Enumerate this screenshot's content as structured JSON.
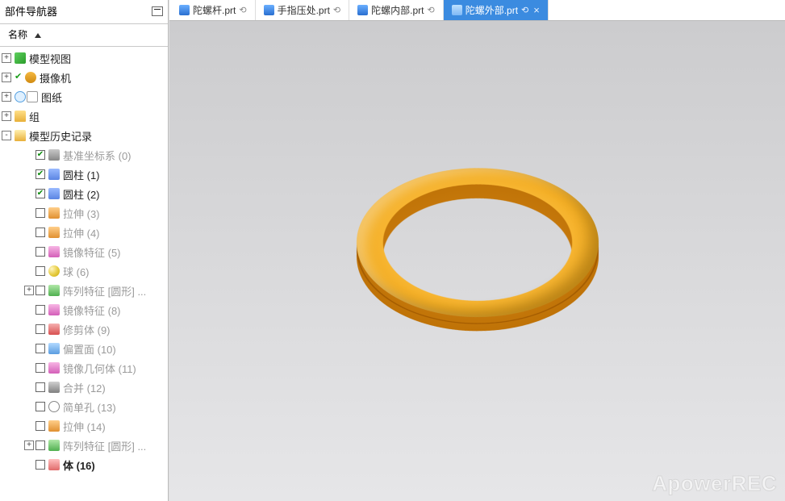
{
  "sidebar": {
    "title": "部件导航器",
    "columnHeader": "名称",
    "nodes": [
      {
        "level": 0,
        "exp": "+",
        "icons": [
          "cube"
        ],
        "label": "模型视图",
        "dim": false,
        "bold": false
      },
      {
        "level": 0,
        "exp": "+",
        "icons": [
          "check",
          "cam"
        ],
        "label": "摄像机",
        "dim": false,
        "bold": false
      },
      {
        "level": 0,
        "exp": "+",
        "icons": [
          "clock",
          "sheet"
        ],
        "label": "图纸",
        "dim": false,
        "bold": false
      },
      {
        "level": 0,
        "exp": "+",
        "icons": [
          "folder"
        ],
        "label": "组",
        "dim": false,
        "bold": false
      },
      {
        "level": 0,
        "exp": "-",
        "icons": [
          "folder-open"
        ],
        "label": "模型历史记录",
        "dim": false,
        "bold": false
      },
      {
        "level": 1,
        "chk": true,
        "icons": [
          "datum"
        ],
        "label": "基准坐标系 (0)",
        "dim": true
      },
      {
        "level": 1,
        "chk": true,
        "icons": [
          "cyl"
        ],
        "label": "圆柱 (1)",
        "dim": false
      },
      {
        "level": 1,
        "chk": true,
        "icons": [
          "cyl"
        ],
        "label": "圆柱 (2)",
        "dim": false
      },
      {
        "level": 1,
        "chk": false,
        "icons": [
          "ext"
        ],
        "label": "拉伸 (3)",
        "dim": true
      },
      {
        "level": 1,
        "chk": false,
        "icons": [
          "ext"
        ],
        "label": "拉伸 (4)",
        "dim": true
      },
      {
        "level": 1,
        "chk": false,
        "icons": [
          "mir"
        ],
        "label": "镜像特征 (5)",
        "dim": true
      },
      {
        "level": 1,
        "chk": false,
        "icons": [
          "sphere"
        ],
        "label": "球 (6)",
        "dim": true
      },
      {
        "level": 1,
        "exp": "+",
        "chk": false,
        "icons": [
          "patt"
        ],
        "label": "阵列特征 [圆形] ...",
        "dim": true
      },
      {
        "level": 1,
        "chk": false,
        "icons": [
          "mir"
        ],
        "label": "镜像特征 (8)",
        "dim": true
      },
      {
        "level": 1,
        "chk": false,
        "icons": [
          "trim"
        ],
        "label": "修剪体 (9)",
        "dim": true
      },
      {
        "level": 1,
        "chk": false,
        "icons": [
          "off"
        ],
        "label": "偏置面 (10)",
        "dim": true
      },
      {
        "level": 1,
        "chk": false,
        "icons": [
          "mir"
        ],
        "label": "镜像几何体 (11)",
        "dim": true
      },
      {
        "level": 1,
        "chk": false,
        "icons": [
          "mrg"
        ],
        "label": "合并 (12)",
        "dim": true
      },
      {
        "level": 1,
        "chk": false,
        "icons": [
          "hole"
        ],
        "label": "简单孔 (13)",
        "dim": true
      },
      {
        "level": 1,
        "chk": false,
        "icons": [
          "ext"
        ],
        "label": "拉伸 (14)",
        "dim": true
      },
      {
        "level": 1,
        "exp": "+",
        "chk": false,
        "icons": [
          "patt"
        ],
        "label": "阵列特征 [圆形] ...",
        "dim": true
      },
      {
        "level": 1,
        "chk": false,
        "icons": [
          "body"
        ],
        "label": "体 (16)",
        "dim": false,
        "bold": true
      }
    ]
  },
  "tabs": [
    {
      "label": "陀螺杆.prt",
      "pinned": true,
      "active": false
    },
    {
      "label": "手指压处.prt",
      "pinned": true,
      "active": false
    },
    {
      "label": "陀螺内部.prt",
      "pinned": true,
      "active": false
    },
    {
      "label": "陀螺外部.prt",
      "pinned": true,
      "active": true,
      "closable": true
    }
  ],
  "watermark": "ApowerREC"
}
